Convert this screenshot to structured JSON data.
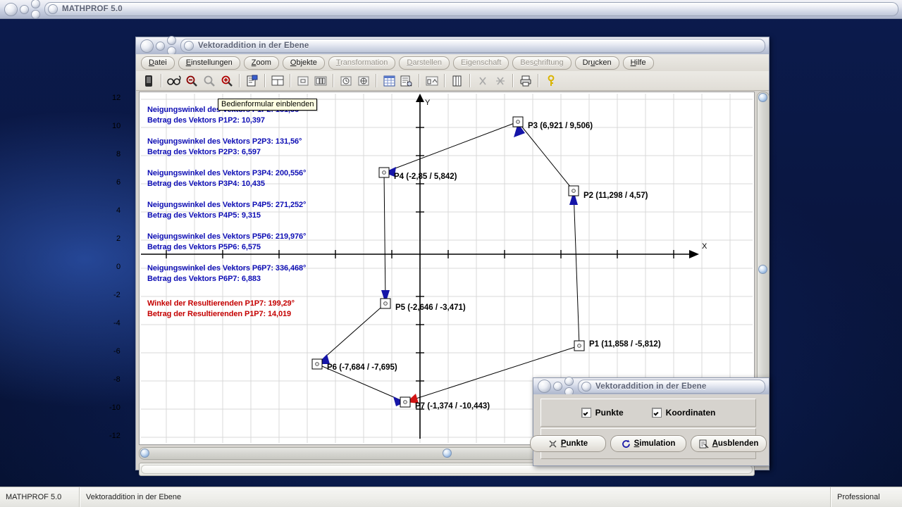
{
  "app": {
    "title": "MATHPROF 5.0"
  },
  "child_window": {
    "title": "Vektoraddition in der Ebene"
  },
  "menu": {
    "items": [
      {
        "label": "Datei",
        "enabled": true
      },
      {
        "label": "Einstellungen",
        "enabled": true
      },
      {
        "label": "Zoom",
        "enabled": true
      },
      {
        "label": "Objekte",
        "enabled": true
      },
      {
        "label": "Transformation",
        "enabled": false
      },
      {
        "label": "Darstellen",
        "enabled": false
      },
      {
        "label": "Eigenschaft",
        "enabled": false
      },
      {
        "label": "Beschriftung",
        "enabled": false
      },
      {
        "label": "Drucken",
        "enabled": true
      },
      {
        "label": "Hilfe",
        "enabled": true
      }
    ]
  },
  "toolbar": {
    "buttons": [
      {
        "name": "module-icon"
      },
      {
        "name": "glasses-icon"
      },
      {
        "name": "zoom-out-icon"
      },
      {
        "name": "zoom-reset-icon"
      },
      {
        "name": "zoom-in-icon"
      },
      {
        "name": "properties-icon"
      },
      {
        "name": "window-layout-icon"
      },
      {
        "name": "single-pane-icon"
      },
      {
        "name": "split-pane-icon"
      },
      {
        "name": "clock-icon"
      },
      {
        "name": "target-icon"
      },
      {
        "name": "table-icon"
      },
      {
        "name": "report-icon"
      },
      {
        "name": "chart-compare-icon"
      },
      {
        "name": "book-icon"
      },
      {
        "name": "cut-icon"
      },
      {
        "name": "cut-all-icon"
      },
      {
        "name": "print-icon"
      },
      {
        "name": "help-key-icon"
      }
    ]
  },
  "tooltip": {
    "text": "Bedienformular einblenden"
  },
  "legend": {
    "entries": [
      {
        "angle": "Neigungswinkel des Vektors P1P2: 131,56°",
        "magnitude": "Betrag des Vektors P1P2: 10,397",
        "color": "#0d0db4"
      },
      {
        "angle": "Neigungswinkel des Vektors P2P3: 131,56°",
        "magnitude": "Betrag des Vektors P2P3: 6,597",
        "color": "#0d0db4"
      },
      {
        "angle": "Neigungswinkel des Vektors P3P4: 200,556°",
        "magnitude": "Betrag des Vektors P3P4: 10,435",
        "color": "#0d0db4"
      },
      {
        "angle": "Neigungswinkel des Vektors P4P5: 271,252°",
        "magnitude": "Betrag des Vektors P4P5: 9,315",
        "color": "#0d0db4"
      },
      {
        "angle": "Neigungswinkel des Vektors P5P6: 219,976°",
        "magnitude": "Betrag des Vektors P5P6: 6,575",
        "color": "#0d0db4"
      },
      {
        "angle": "Neigungswinkel des Vektors P6P7: 336,468°",
        "magnitude": "Betrag des Vektors P6P7: 6,883",
        "color": "#0d0db4"
      },
      {
        "angle": "Winkel der Resultierenden P1P7: 199,29°",
        "magnitude": "Betrag der Resultierenden P1P7: 14,019",
        "color": "#c40000"
      }
    ]
  },
  "chart_data": {
    "type": "scatter",
    "title": "",
    "xlabel": "X",
    "ylabel": "Y",
    "xlim": [
      -21.5,
      6.5
    ],
    "ylim": [
      -12.5,
      12.5
    ],
    "xticks": [
      -20,
      -16,
      -12,
      -8,
      -4,
      0,
      4
    ],
    "yticks": [
      -12,
      -10,
      -8,
      -6,
      -4,
      -2,
      0,
      2,
      4,
      6,
      8,
      10,
      12
    ],
    "grid": true,
    "points": [
      {
        "name": "P1",
        "x": 11.858,
        "y": -5.812,
        "label": "P1 (11,858 / -5,812)"
      },
      {
        "name": "P2",
        "x": 11.298,
        "y": 4.57,
        "label": "P2 (11,298 / 4,57)"
      },
      {
        "name": "P3",
        "x": 6.921,
        "y": 9.506,
        "label": "P3 (6,921 / 9,506)"
      },
      {
        "name": "P4",
        "x": -2.85,
        "y": 5.842,
        "label": "P4 (-2,85 / 5,842)"
      },
      {
        "name": "P5",
        "x": -2.646,
        "y": -3.471,
        "label": "P5 (-2,646 / -3,471)"
      },
      {
        "name": "P6",
        "x": -7.684,
        "y": -7.695,
        "label": "P6 (-7,684 / -7,695)"
      },
      {
        "name": "P7",
        "x": -1.374,
        "y": -10.443,
        "label": "P7 (-1,374 / -10,443)"
      }
    ],
    "vectors": [
      {
        "from": "P1",
        "to": "P2",
        "angle": 131.56,
        "magnitude": 10.397
      },
      {
        "from": "P2",
        "to": "P3",
        "angle": 131.56,
        "magnitude": 6.597
      },
      {
        "from": "P3",
        "to": "P4",
        "angle": 200.556,
        "magnitude": 10.435
      },
      {
        "from": "P4",
        "to": "P5",
        "angle": 271.252,
        "magnitude": 9.315
      },
      {
        "from": "P5",
        "to": "P6",
        "angle": 219.976,
        "magnitude": 6.575
      },
      {
        "from": "P6",
        "to": "P7",
        "angle": 336.468,
        "magnitude": 6.883
      }
    ],
    "resultant": {
      "from": "P1",
      "to": "P7",
      "angle": 199.29,
      "magnitude": 14.019,
      "color": "#c40000"
    }
  },
  "dialog": {
    "title": "Vektoraddition in der Ebene",
    "checkboxes": [
      {
        "label": "Punkte",
        "checked": true
      },
      {
        "label": "Koordinaten",
        "checked": true
      }
    ],
    "buttons": [
      {
        "label": "Punkte",
        "icon": "points-icon"
      },
      {
        "label": "Simulation",
        "icon": "refresh-icon"
      },
      {
        "label": "Ausblenden",
        "icon": "hide-icon"
      }
    ]
  },
  "statusbar": {
    "product": "MATHPROF 5.0",
    "context": "Vektoraddition in der Ebene",
    "edition": "Professional"
  }
}
